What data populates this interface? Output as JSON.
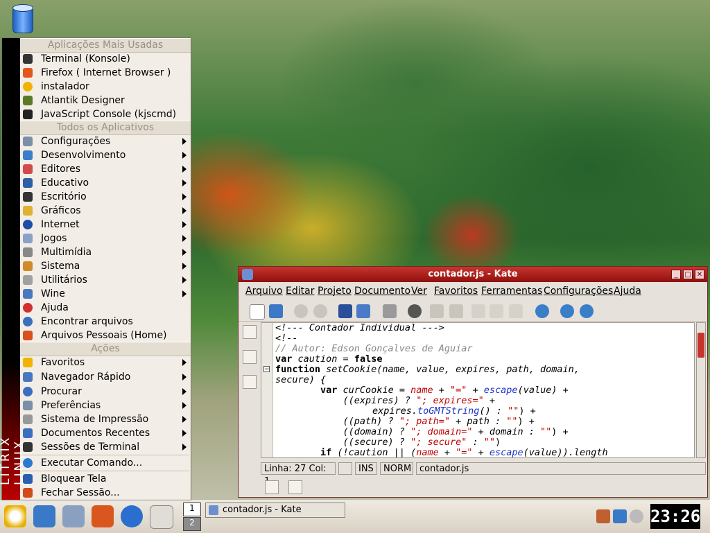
{
  "start_menu": {
    "sidebar_text": "LITRIX LINUX",
    "headers": {
      "most_used": "Aplicações Mais Usadas",
      "all_apps": "Todos os Aplicativos",
      "actions": "Ações"
    },
    "most_used": [
      "Terminal (Konsole)",
      "Firefox ( Internet Browser )",
      "instalador",
      "Atlantik Designer",
      "JavaScript Console (kjscmd)"
    ],
    "apps": [
      "Configurações",
      "Desenvolvimento",
      "Editores",
      "Educativo",
      "Escritório",
      "Gráficos",
      "Internet",
      "Jogos",
      "Multimídia",
      "Sistema",
      "Utilitários",
      "Wine",
      "Ajuda",
      "Encontrar arquivos",
      "Arquivos Pessoais (Home)"
    ],
    "actions": [
      "Favoritos",
      "Navegador Rápido",
      "Procurar",
      "Preferências",
      "Sistema de Impressão",
      "Documentos Recentes",
      "Sessões de Terminal"
    ],
    "bottom": [
      "Executar Comando...",
      "Bloquear Tela",
      "Fechar Sessão..."
    ]
  },
  "kate": {
    "title": "contador.js - Kate",
    "menu": [
      "Arquivo",
      "Editar",
      "Projeto",
      "Documento",
      "Ver",
      "Favoritos",
      "Ferramentas",
      "Configurações",
      "Ajuda"
    ],
    "status": {
      "position": "Linha: 27 Col: 1",
      "ins": "INS",
      "norm": "NORM",
      "file": "contador.js"
    },
    "code": {
      "l1": "<!--- Contador Individual --->",
      "l2": "<!--",
      "l3": "// Autor: Edson Gonçalves de Aguiar",
      "l4a": "var ",
      "l4b": "caution",
      "l4c": " = ",
      "l4d": "false",
      "l5a": "function ",
      "l5b": "setCookie(name, value, expires, path, domain,",
      "l6": "secure) {",
      "l7a": "        var ",
      "l7b": "curCookie = ",
      "l7c": "name",
      "l7d": " + ",
      "l7e": "\"=\"",
      "l7f": " + ",
      "l7g": "escape",
      "l7h": "(value) +",
      "l8a": "            ((expires) ? ",
      "l8b": "\"; expires=\"",
      "l8c": " +",
      "l9a": "expires.",
      "l9b": "toGMTString",
      "l9c": "() : ",
      "l9d": "\"\"",
      "l9e": ") +",
      "l10a": "            ((path) ? ",
      "l10b": "\"; path=\"",
      "l10c": " + path : ",
      "l10d": "\"\"",
      "l10e": ") +",
      "l11a": "            ((domain) ? ",
      "l11b": "\"; domain=\"",
      "l11c": " + domain : ",
      "l11d": "\"\"",
      "l11e": ") +",
      "l12a": "            ((secure) ? ",
      "l12b": "\"; secure\"",
      "l12c": " : ",
      "l12d": "\"\"",
      "l12e": ")",
      "l13a": "        if ",
      "l13b": "(!caution || (",
      "l13c": "name",
      "l13d": " + ",
      "l13e": "\"=\"",
      "l13f": " + ",
      "l13g": "escape",
      "l13h": "(value)).length"
    }
  },
  "taskbar": {
    "pager": [
      "1",
      "2"
    ],
    "task": "contador.js - Kate",
    "clock": "23:26"
  }
}
